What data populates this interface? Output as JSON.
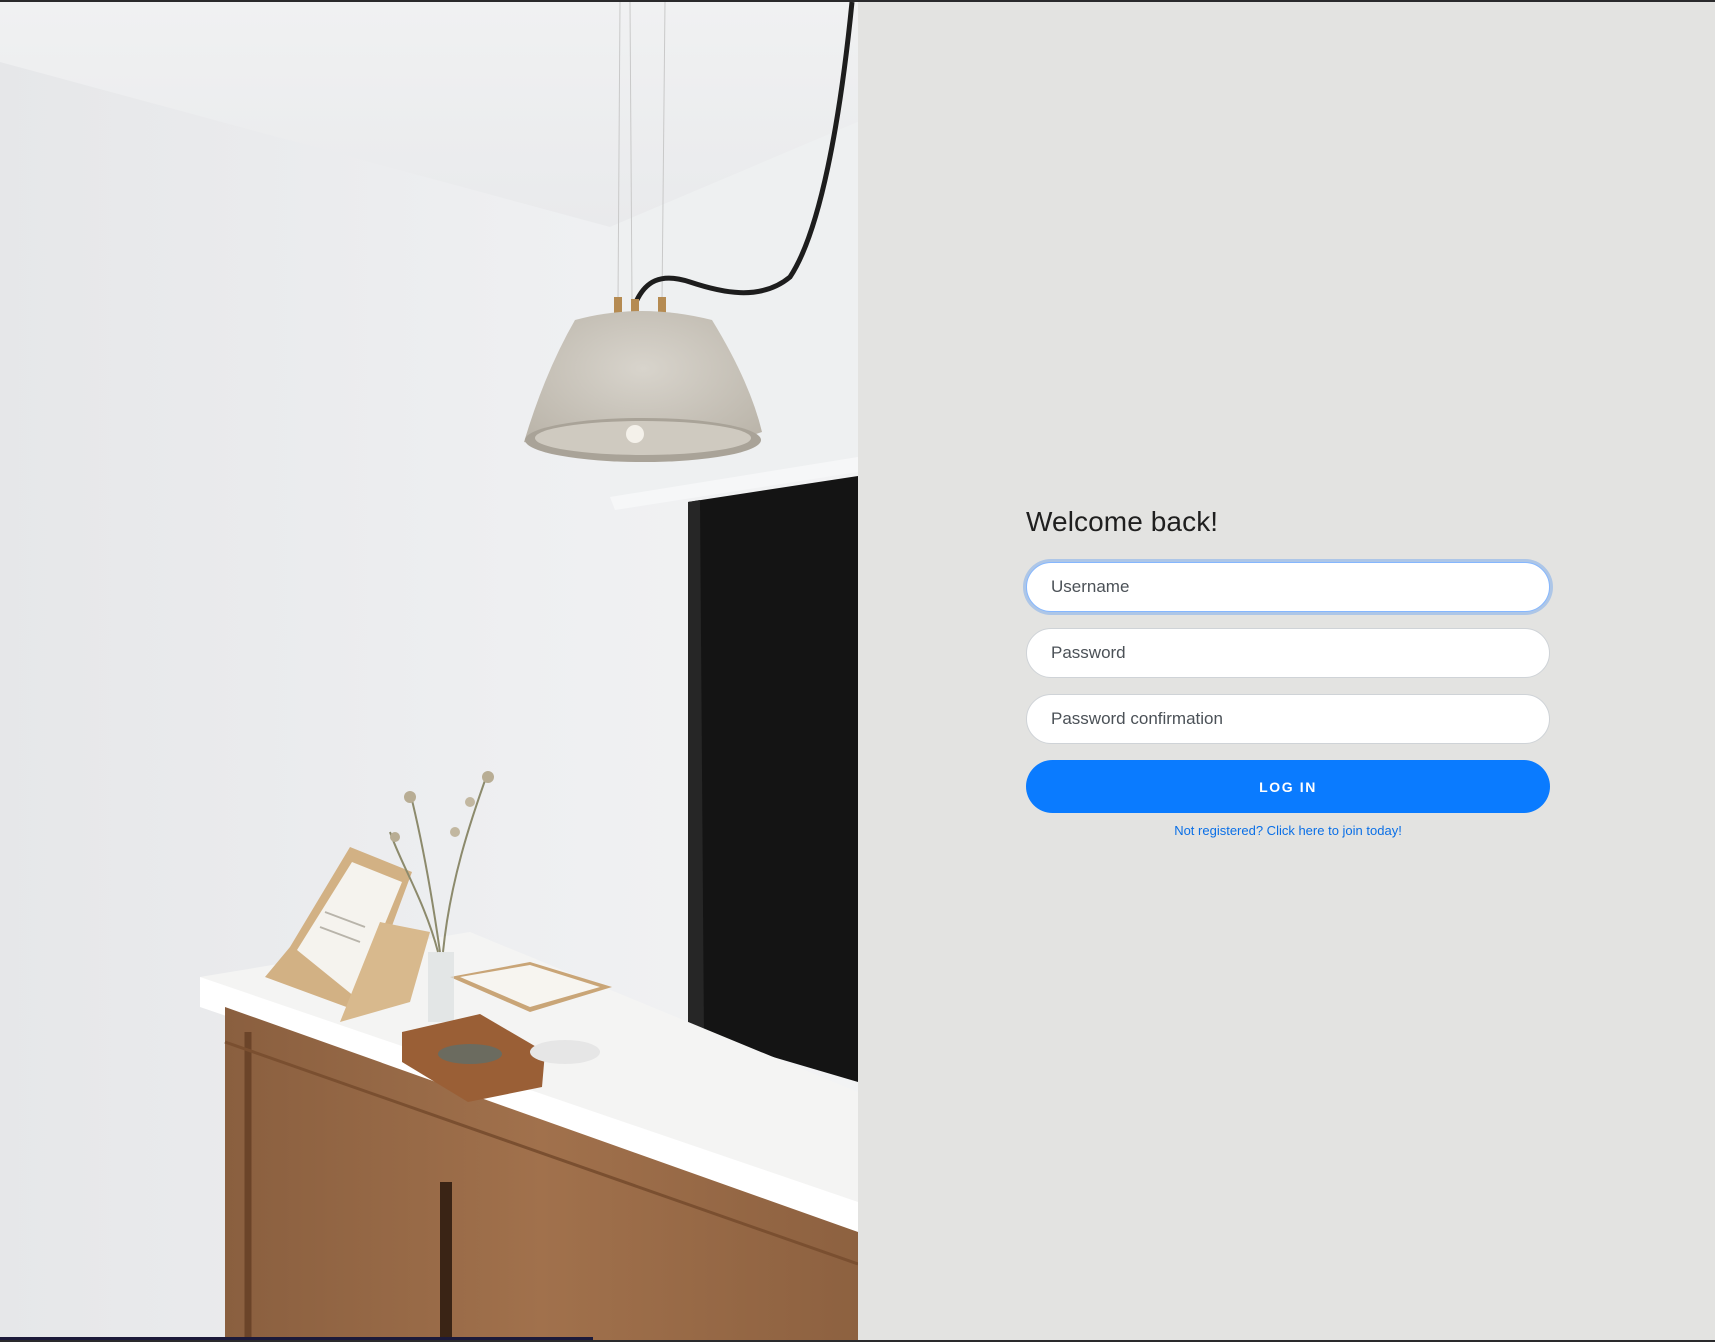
{
  "photo": {
    "description_icon": "interior-photo"
  },
  "form": {
    "title": "Welcome back!",
    "username_placeholder": "Username",
    "password_placeholder": "Password",
    "password_confirmation_placeholder": "Password confirmation",
    "login_label": "LOG IN",
    "register_link": "Not registered? Click here to join today!"
  },
  "colors": {
    "accent": "#0a7bff",
    "panel_background": "#e3e3e1",
    "link": "#0a6fe6"
  }
}
